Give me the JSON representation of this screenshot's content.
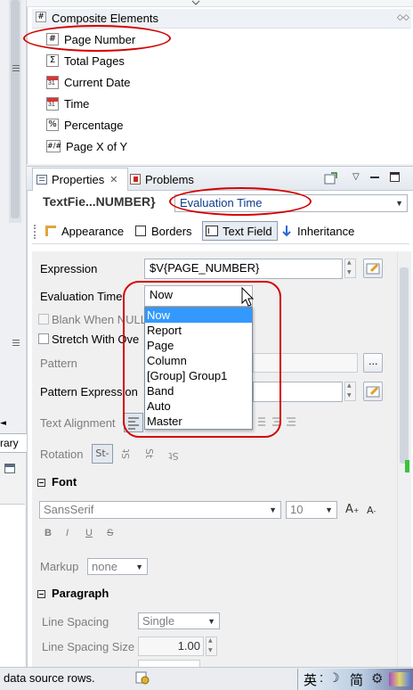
{
  "palette": {
    "section_label": "Composite Elements",
    "items": [
      {
        "icon": "#",
        "label": "Page Number"
      },
      {
        "icon": "Σ",
        "label": "Total Pages"
      },
      {
        "icon": "calendar",
        "label": "Current Date"
      },
      {
        "icon": "calendar",
        "label": "Time"
      },
      {
        "icon": "%",
        "label": "Percentage"
      },
      {
        "icon": "#/#",
        "label": "Page X of Y"
      }
    ]
  },
  "left_strip": {
    "partial_label": "rary"
  },
  "views": {
    "tabs": [
      {
        "label": "Properties",
        "active": true
      },
      {
        "label": "Problems",
        "active": false
      }
    ]
  },
  "properties": {
    "element_title": "TextFie...NUMBER}",
    "header_combo_value": "Evaluation Time",
    "inner_tabs": [
      "Appearance",
      "Borders",
      "Text Field",
      "Inheritance"
    ],
    "selected_inner_tab": "Text Field",
    "expression_label": "Expression",
    "expression_value": "$V{PAGE_NUMBER}",
    "evaluation_time_label": "Evaluation Time",
    "evaluation_time_value": "Now",
    "blank_when_null_label": "Blank When NULL",
    "stretch_with_overflow_label": "Stretch With Ove",
    "pattern_label": "Pattern",
    "pattern_expression_label": "Pattern Expression",
    "text_alignment_label": "Text Alignment",
    "rotation_label": "Rotation",
    "rotation_options": [
      "St-",
      "St",
      "St",
      "St"
    ],
    "font_section": "Font",
    "font_family": "SansSerif",
    "font_size": "10",
    "font_style_buttons": [
      "B",
      "I",
      "U",
      "S"
    ],
    "markup_label": "Markup",
    "markup_value": "none",
    "paragraph_section": "Paragraph",
    "line_spacing_label": "Line Spacing",
    "line_spacing_value": "Single",
    "line_spacing_size_label": "Line Spacing Size",
    "line_spacing_size_value": "1.00"
  },
  "evaluation_dropdown": {
    "options": [
      "Now",
      "Report",
      "Page",
      "Column",
      "[Group] Group1",
      "Band",
      "Auto",
      "Master"
    ],
    "selected": "Now"
  },
  "status_bar": {
    "text": "data source rows.",
    "ime_label_1": "英",
    "ime_label_2": "简"
  },
  "colors": {
    "selection": "#3399ff",
    "annotation": "#d40000"
  }
}
